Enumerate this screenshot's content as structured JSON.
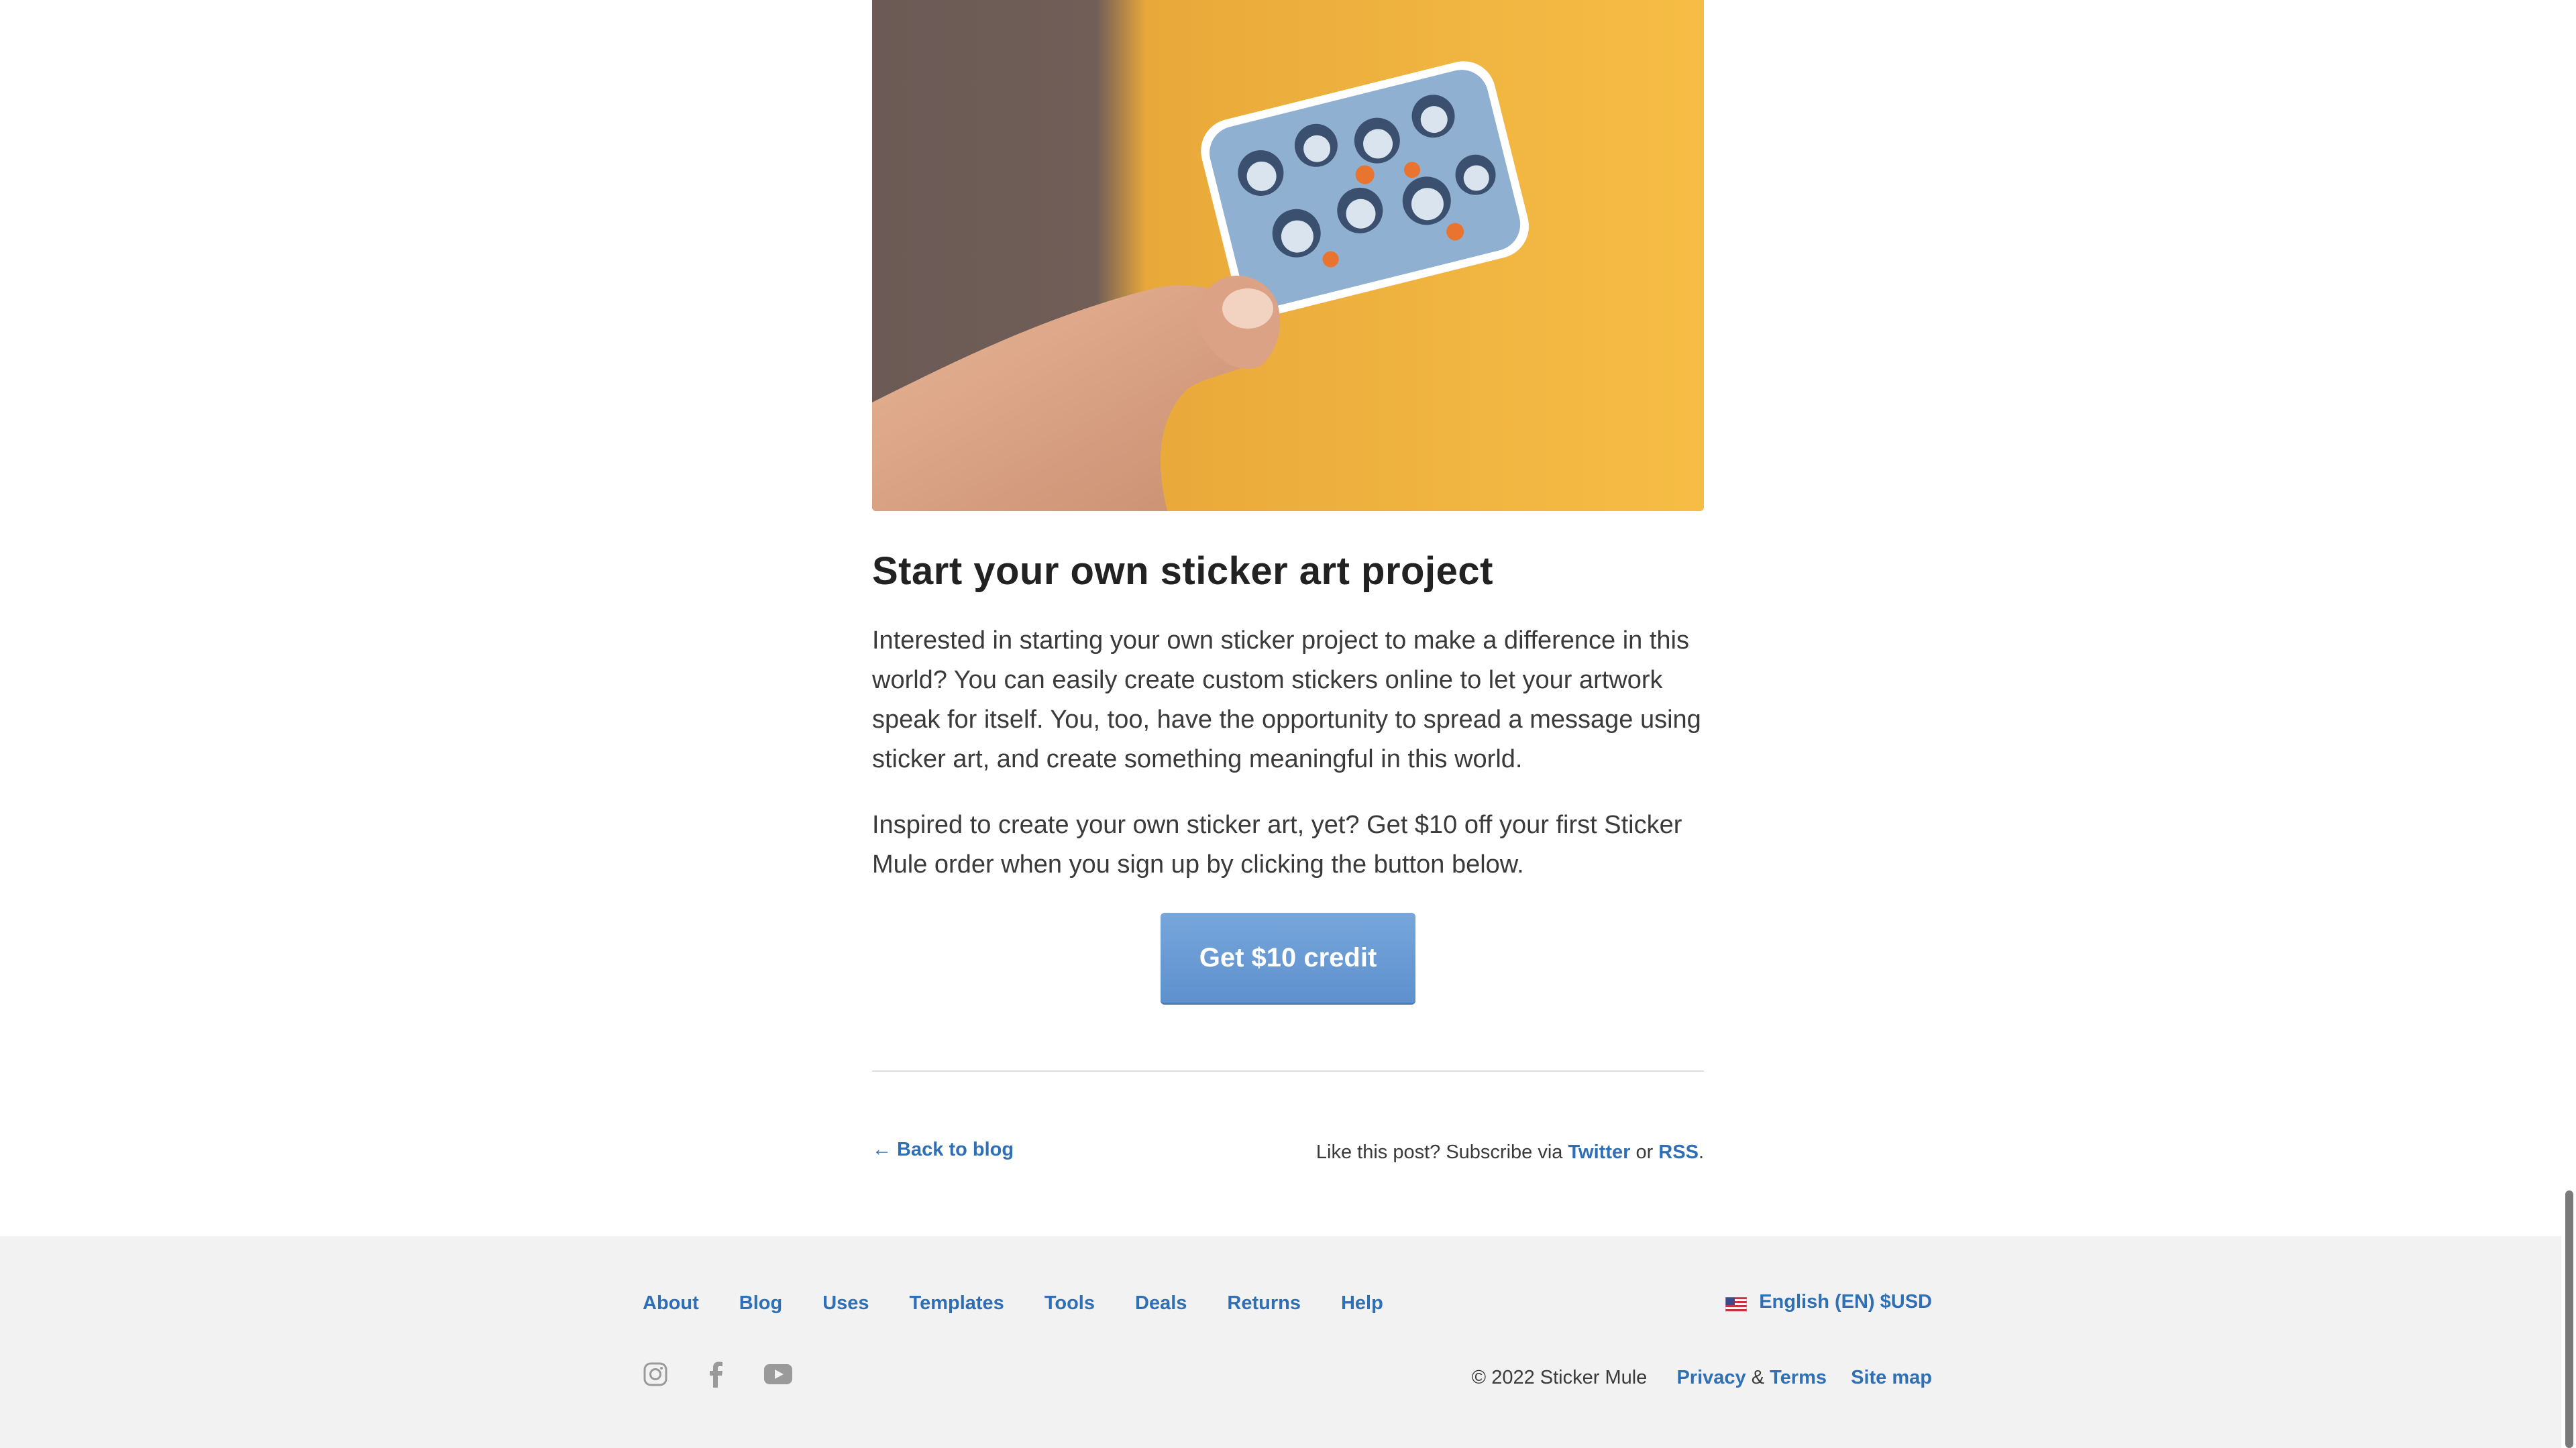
{
  "article": {
    "hero_image": "hand holding illustrated sticker of diverse faces",
    "title": "Start your own sticker art project",
    "paragraph_1": "Interested in starting your own sticker project to make a difference in this world? You can easily create custom stickers online to let your artwork speak for itself. You, too, have the opportunity to spread a message using sticker art, and create something meaningful in this world.",
    "paragraph_2": "Inspired to create your own sticker art, yet? Get $10 off your first Sticker Mule order when you sign up by clicking the button below.",
    "cta_label": "Get $10 credit",
    "back_link": "← Back to blog",
    "subscribe_prefix": "Like this post? Subscribe via ",
    "twitter_label": "Twitter",
    "subscribe_or": " or ",
    "rss_label": "RSS",
    "subscribe_suffix": "."
  },
  "footer": {
    "nav": [
      "About",
      "Blog",
      "Uses",
      "Templates",
      "Tools",
      "Deals",
      "Returns",
      "Help"
    ],
    "locale_label": "English (EN) $USD",
    "social_icons": [
      "instagram-icon",
      "facebook-icon",
      "youtube-icon"
    ],
    "copyright": "© 2022 Sticker Mule",
    "privacy_label": "Privacy",
    "amp": " & ",
    "terms_label": "Terms",
    "sitemap_label": "Site map"
  },
  "colors": {
    "link": "#2f6fb5",
    "cta": "#6a9bd6",
    "footer_bg": "#f2f2f2",
    "hero_orange": "#f5b83d"
  }
}
